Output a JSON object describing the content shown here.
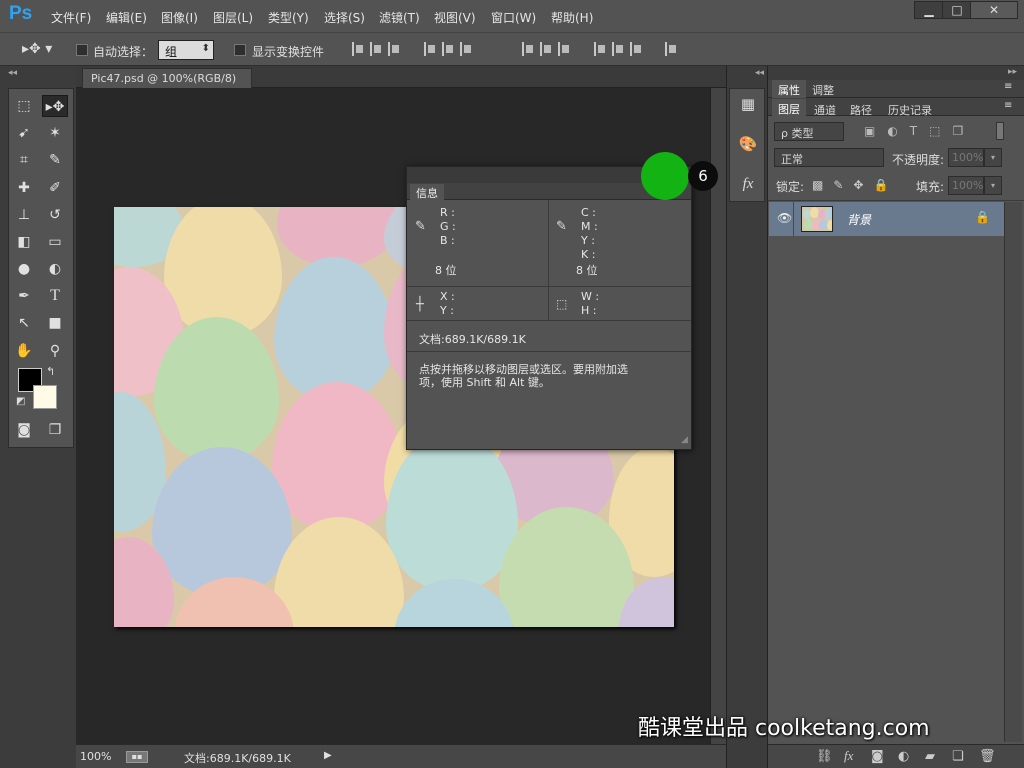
{
  "app": {
    "logo": "Ps",
    "menu": [
      "文件(F)",
      "编辑(E)",
      "图像(I)",
      "图层(L)",
      "类型(Y)",
      "选择(S)",
      "滤镜(T)",
      "视图(V)",
      "窗口(W)",
      "帮助(H)"
    ],
    "window_controls": [
      "▁",
      "□",
      "✕"
    ]
  },
  "options": {
    "auto_select_label": "自动选择：",
    "auto_select_value": "组",
    "show_transform_label": "显示变换控件"
  },
  "document": {
    "tab_title": "Pic47.psd @ 100%(RGB/8)",
    "tab_close": "×",
    "zoom": "100%",
    "status_doc": "文档:689.1K/689.1K"
  },
  "right_panel": {
    "tabs_top": [
      "属性",
      "调整"
    ],
    "tabs_layers": [
      "图层",
      "通道",
      "路径",
      "历史记录"
    ],
    "filter_kind": "ρ 类型",
    "blend_mode": "正常",
    "opacity_label": "不透明度:",
    "opacity_value": "100%",
    "lock_label": "锁定:",
    "fill_label": "填充:",
    "fill_value": "100%",
    "layer_name": "背景"
  },
  "info_panel": {
    "tab": "信息",
    "rgb_labels": [
      "R :",
      "G :",
      "B :"
    ],
    "cmyk_labels": [
      "C :",
      "M :",
      "Y :",
      "K :"
    ],
    "bit_left": "8 位",
    "bit_right": "8 位",
    "xy_labels": [
      "X :",
      "Y :"
    ],
    "wh_labels": [
      "W :",
      "H :"
    ],
    "doc_size": "文档:689.1K/689.1K",
    "hint_line1": "点按并拖移以移动图层或选区。要用附加选",
    "hint_line2": "项，使用 Shift 和 Alt 键。"
  },
  "overlay": {
    "step_number": "6",
    "watermark": "酷课堂出品 coolketang.com"
  },
  "colors": {
    "foreground": "#000000",
    "background": "#fffbe6",
    "highlight_dot": "#12b312",
    "layer_selected": "#697a8f"
  }
}
